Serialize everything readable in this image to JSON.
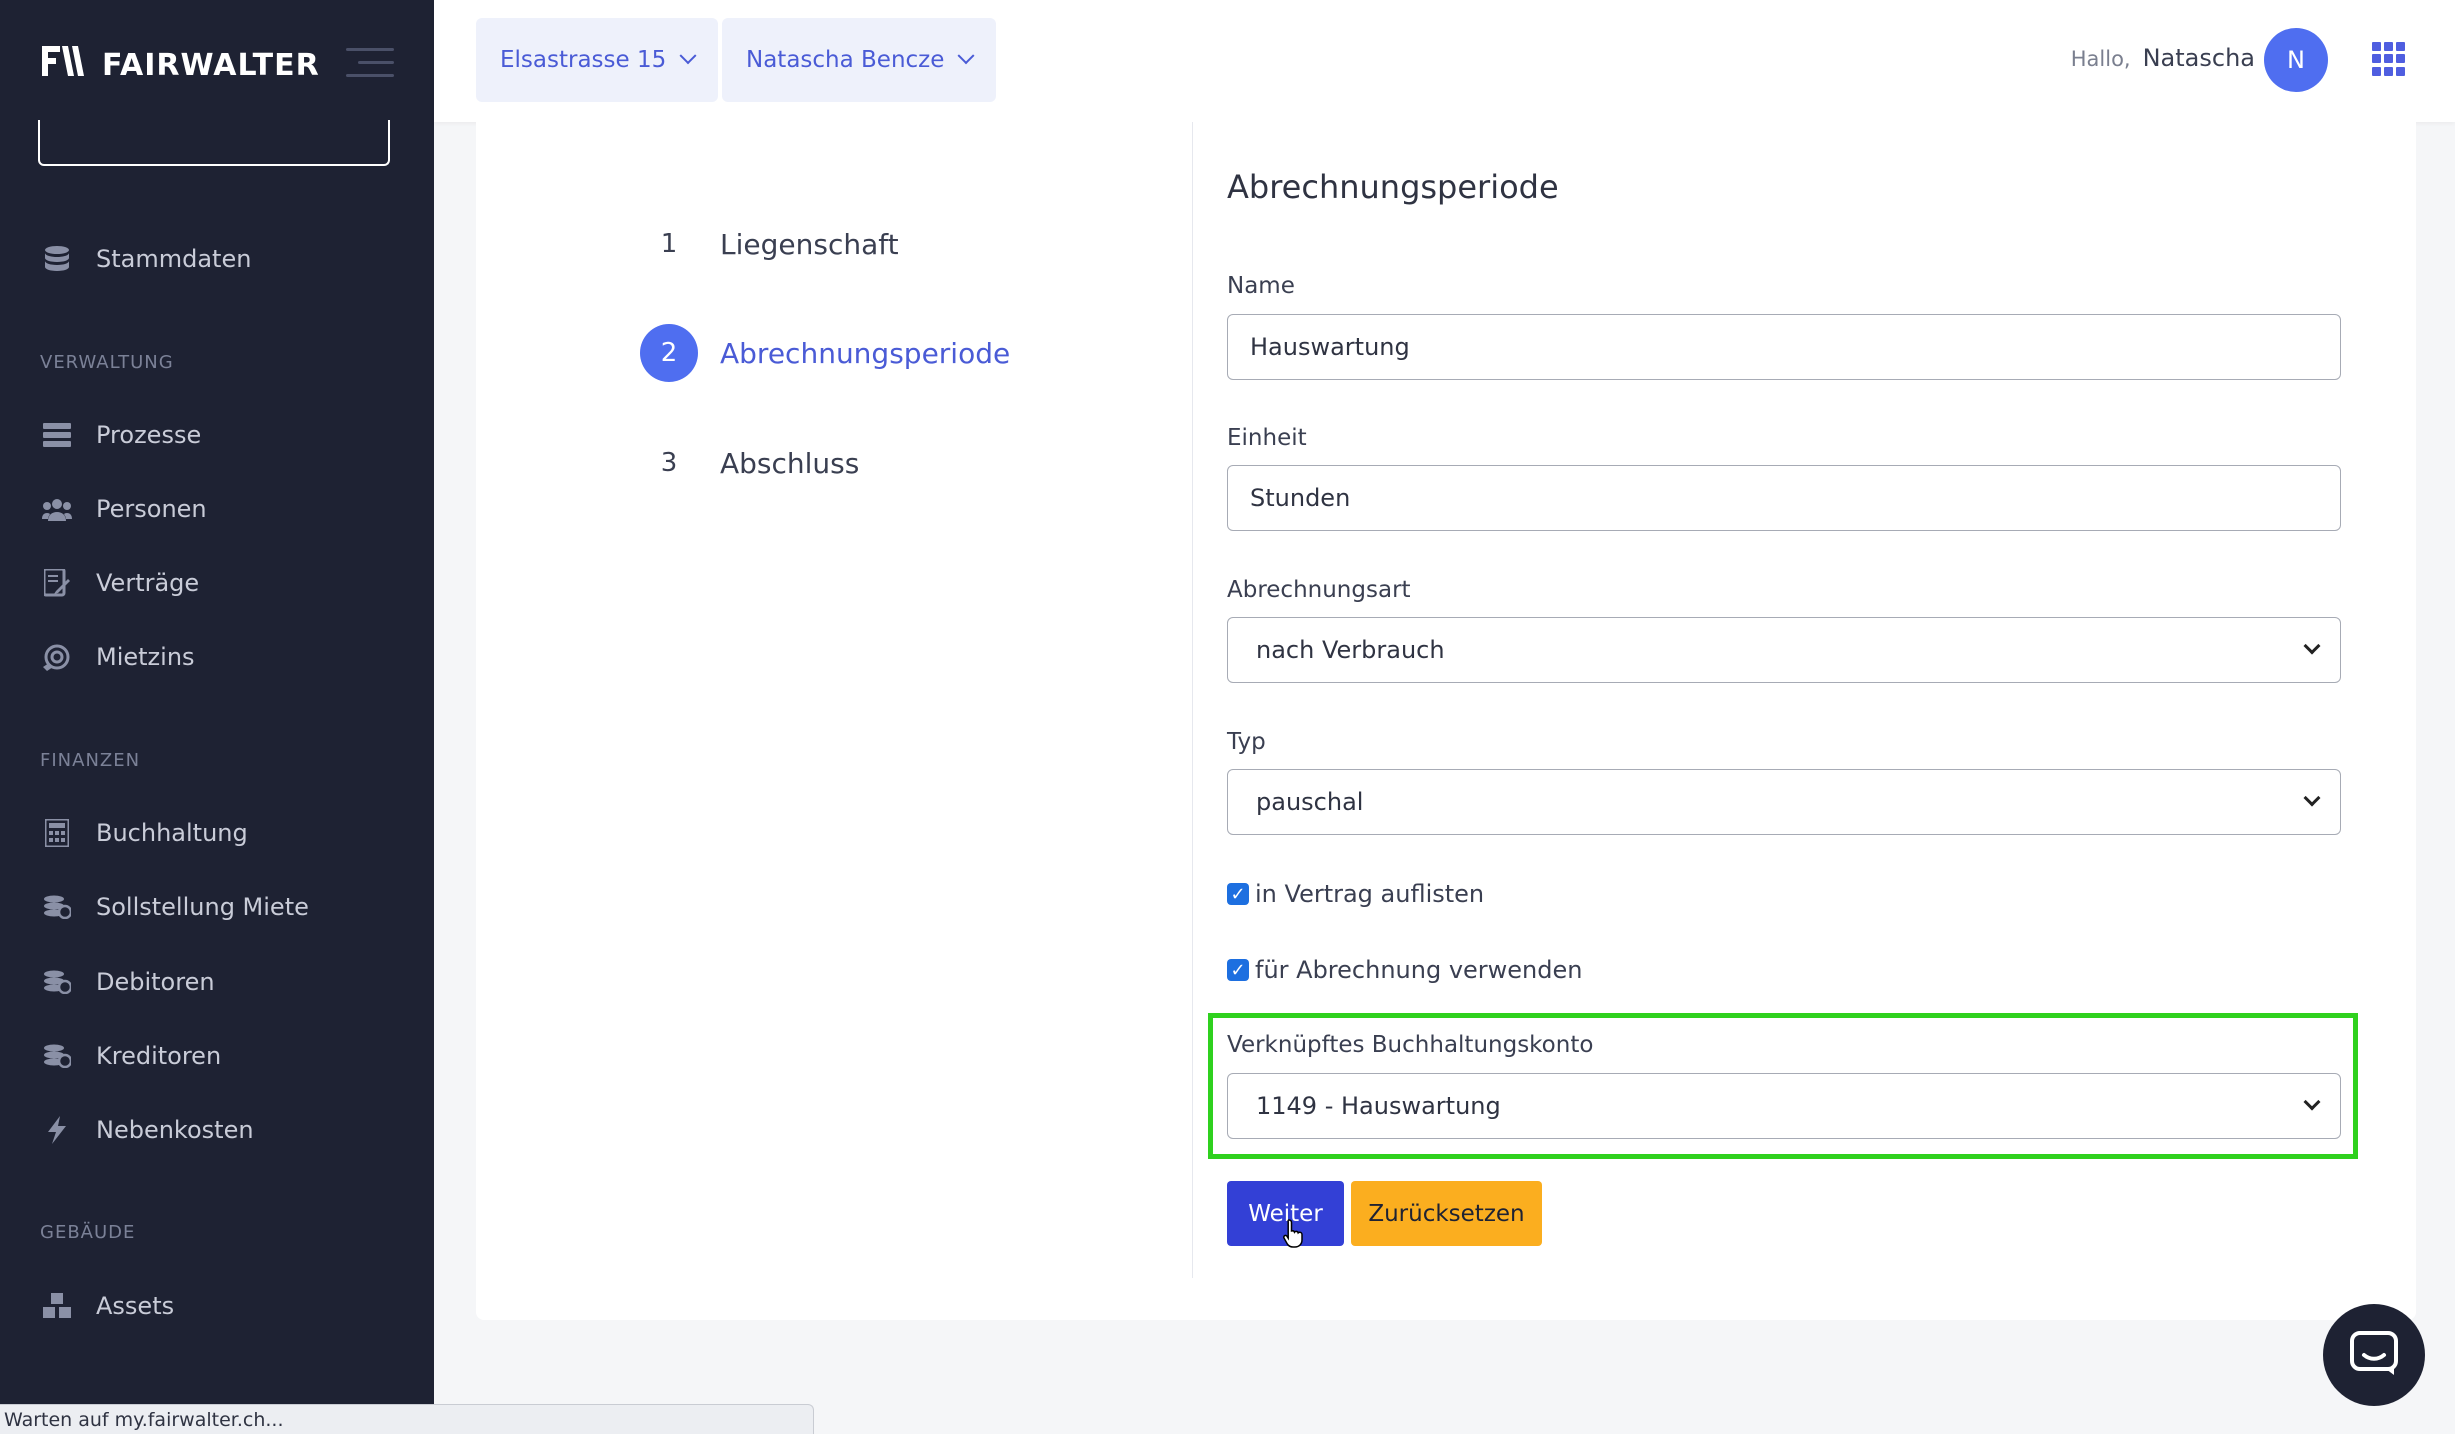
{
  "app": {
    "logo_text": "FAIRWALTER"
  },
  "sidebar": {
    "items": [
      {
        "label": "Stammdaten",
        "icon": "database-icon"
      },
      {
        "label": "Prozesse",
        "icon": "server-icon"
      },
      {
        "label": "Personen",
        "icon": "users-icon"
      },
      {
        "label": "Verträge",
        "icon": "contract-icon"
      },
      {
        "label": "Mietzins",
        "icon": "money-icon"
      },
      {
        "label": "Buchhaltung",
        "icon": "calculator-icon"
      },
      {
        "label": "Sollstellung Miete",
        "icon": "coins-icon"
      },
      {
        "label": "Debitoren",
        "icon": "coins-icon"
      },
      {
        "label": "Kreditoren",
        "icon": "coins-icon"
      },
      {
        "label": "Nebenkosten",
        "icon": "bolt-icon"
      },
      {
        "label": "Assets",
        "icon": "boxes-icon"
      }
    ],
    "sections": {
      "verwaltung": "VERWALTUNG",
      "finanzen": "FINANZEN",
      "gebaeude": "GEBÄUDE"
    }
  },
  "header": {
    "property_select": "Elsastrasse 15",
    "user_select": "Natascha Bencze",
    "greeting": "Hallo,",
    "user_name": "Natascha",
    "avatar_initial": "N"
  },
  "steps": [
    {
      "num": "1",
      "label": "Liegenschaft",
      "active": false
    },
    {
      "num": "2",
      "label": "Abrechnungsperiode",
      "active": true
    },
    {
      "num": "3",
      "label": "Abschluss",
      "active": false
    }
  ],
  "form": {
    "title": "Abrechnungsperiode",
    "name_label": "Name",
    "name_value": "Hauswartung",
    "unit_label": "Einheit",
    "unit_value": "Stunden",
    "billing_type_label": "Abrechnungsart",
    "billing_type_value": "nach Verbrauch",
    "type_label": "Typ",
    "type_value": "pauschal",
    "checkbox_contract": "in Vertrag auflisten",
    "checkbox_billing": "für Abrechnung verwenden",
    "account_label": "Verknüpftes Buchhaltungskonto",
    "account_value": "1149 - Hauswartung",
    "next_button": "Weiter",
    "reset_button": "Zurücksetzen"
  },
  "status": {
    "text": "Warten auf my.fairwalter.ch..."
  },
  "colors": {
    "sidebar_bg": "#1e2233",
    "accent": "#4f6ef0",
    "primary_button": "#3340d6",
    "warning_button": "#fbae1f",
    "highlight": "#2fd11e"
  }
}
